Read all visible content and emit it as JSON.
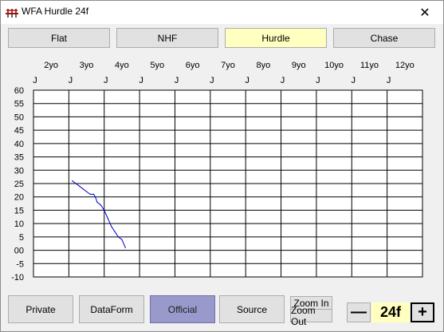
{
  "window": {
    "title": "WFA Hurdle 24f",
    "close_glyph": "✕"
  },
  "tabs": [
    {
      "label": "Flat",
      "active": false
    },
    {
      "label": "NHF",
      "active": false
    },
    {
      "label": "Hurdle",
      "active": true
    },
    {
      "label": "Chase",
      "active": false
    }
  ],
  "chart_data": {
    "type": "line",
    "x_categories": [
      "2yo",
      "3yo",
      "4yo",
      "5yo",
      "6yo",
      "7yo",
      "8yo",
      "9yo",
      "10yo",
      "11yo",
      "12yo"
    ],
    "month_marker": "J",
    "y_ticks": [
      60,
      55,
      50,
      45,
      40,
      35,
      30,
      25,
      20,
      15,
      10,
      5,
      "00",
      -5,
      -10
    ],
    "ylim": [
      -10,
      60
    ],
    "grid": true,
    "series": [
      {
        "color": "#0000cc",
        "x": [
          3.1,
          3.2,
          3.3,
          3.4,
          3.5,
          3.6,
          3.7,
          3.75,
          3.8,
          3.9,
          4.0,
          4.1,
          4.2,
          4.3,
          4.4,
          4.5,
          4.6
        ],
        "y": [
          26,
          25,
          24,
          23,
          22,
          21,
          21,
          20,
          18,
          17,
          15,
          12,
          9,
          7,
          5,
          4,
          1
        ]
      }
    ]
  },
  "bottom": {
    "private_label": "Private",
    "dataform_label": "DataForm",
    "official_label": "Official",
    "source_label": "Source",
    "zoom_in_label": "Zoom In",
    "zoom_out_label": "Zoom Out",
    "minus_label": "—",
    "distance_value": "24f",
    "plus_label": "+"
  },
  "colors": {
    "active_tab": "#ffffc0",
    "official_active": "#9999cc",
    "line": "#0000cc"
  }
}
